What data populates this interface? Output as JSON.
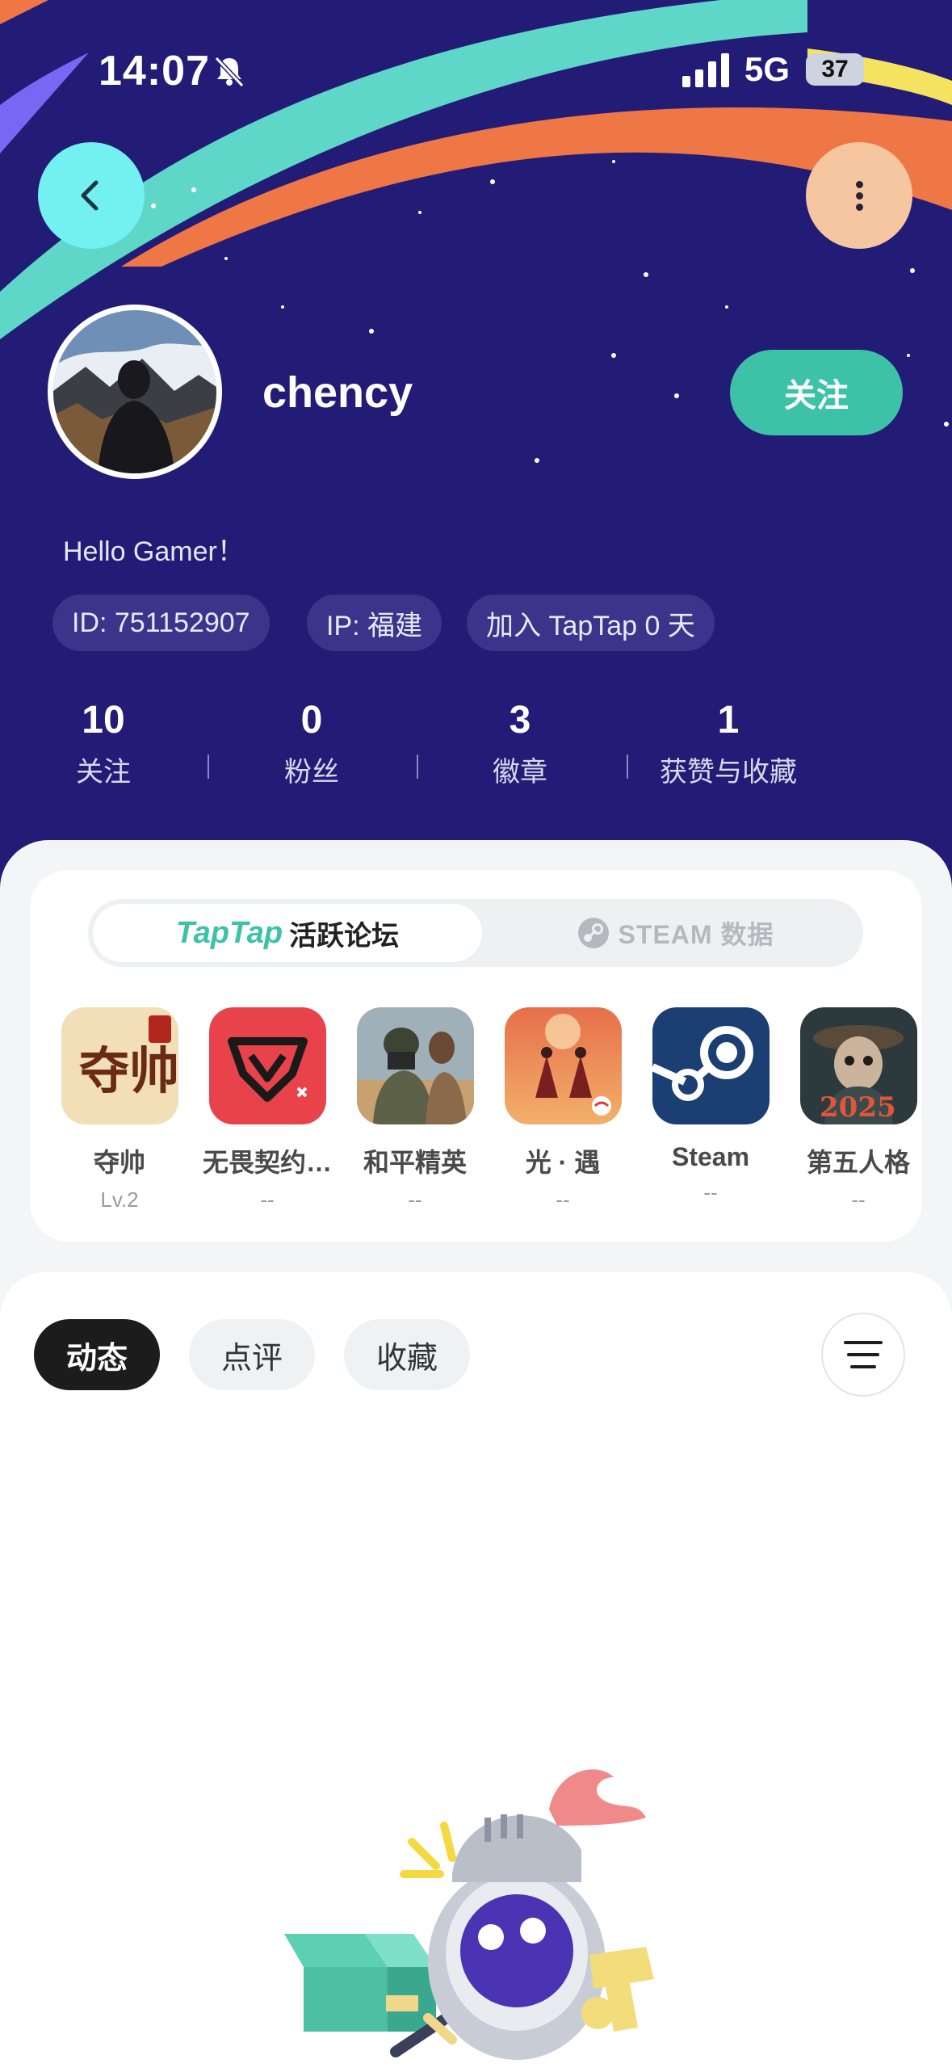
{
  "status_bar": {
    "time": "14:07",
    "network": "5G",
    "battery": "37"
  },
  "profile": {
    "username": "chency",
    "follow_label": "关注",
    "bio": "Hello Gamer！",
    "chips": [
      "ID: 751152907",
      "IP: 福建",
      "加入 TapTap 0 天"
    ]
  },
  "stats": [
    {
      "value": "10",
      "label": "关注"
    },
    {
      "value": "0",
      "label": "粉丝"
    },
    {
      "value": "3",
      "label": "徽章"
    },
    {
      "value": "1",
      "label": "获赞与收藏"
    }
  ],
  "game_tabs": {
    "active_brand": "TapTap",
    "active_label": "活跃论坛",
    "inactive_label": "STEAM 数据"
  },
  "games": [
    {
      "name": "夺帅",
      "level": "Lv.2",
      "icon": "duoshuai-game-icon"
    },
    {
      "name": "无畏契约…",
      "level": "--",
      "icon": "valorant-game-icon"
    },
    {
      "name": "和平精英",
      "level": "--",
      "icon": "peacekeeper-elite-game-icon"
    },
    {
      "name": "光 · 遇",
      "level": "--",
      "icon": "sky-game-icon"
    },
    {
      "name": "Steam",
      "level": "--",
      "icon": "steam-icon"
    },
    {
      "name": "第五人格",
      "level": "--",
      "icon": "identity-v-game-icon"
    }
  ],
  "feed_tabs": [
    "动态",
    "点评",
    "收藏"
  ],
  "colors": {
    "hero_bg": "#221c77",
    "accent": "#3dc2a7",
    "back_button": "#73f0f0",
    "more_button": "#f6c6a0"
  }
}
